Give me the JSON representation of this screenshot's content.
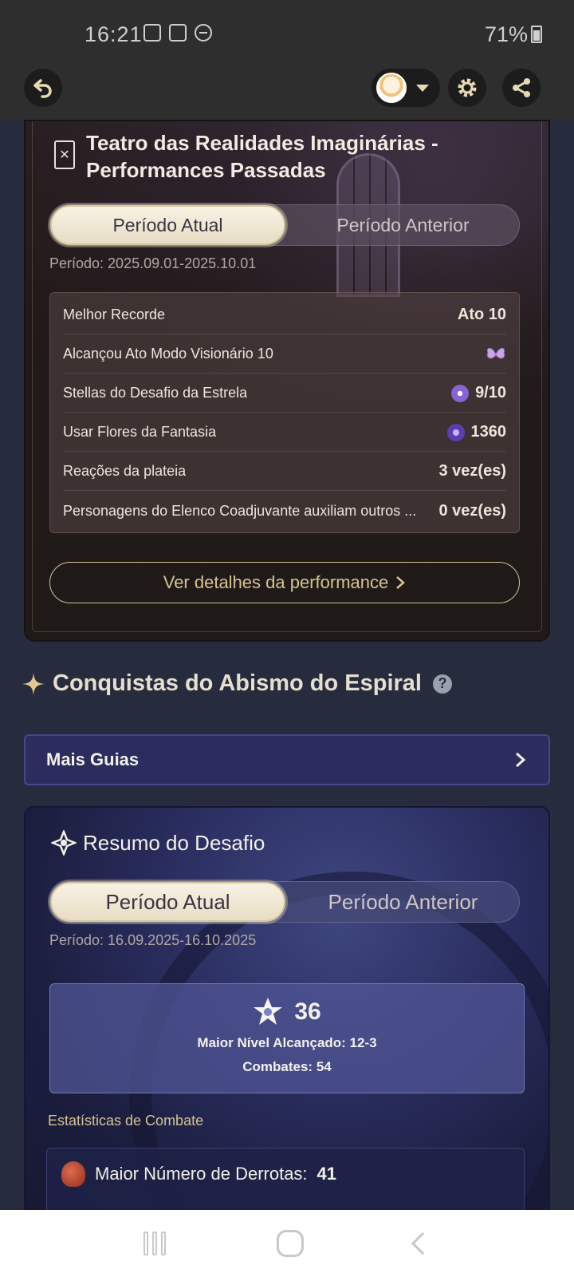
{
  "status_bar": {
    "time": "16:21",
    "battery": "71%"
  },
  "toolbar": {
    "back_icon": "back-arrow-icon",
    "settings_icon": "gear-icon",
    "share_icon": "share-icon"
  },
  "theater": {
    "title": "Teatro das Realidades Imaginárias - Performances Passadas",
    "tabs": [
      "Período Atual",
      "Período Anterior"
    ],
    "period": "Período: 2025.09.01-2025.10.01",
    "stats": [
      {
        "label": "Melhor Recorde",
        "value": "Ato 10"
      },
      {
        "label": "Alcançou Ato Modo Visionário 10",
        "value": ""
      },
      {
        "label": "Stellas do Desafio da Estrela",
        "value": "9/10"
      },
      {
        "label": "Usar Flores da Fantasia",
        "value": "1360"
      },
      {
        "label": "Reações da plateia",
        "value": "3 vez(es)"
      },
      {
        "label": "Personagens do Elenco Coadjuvante auxiliam outros ...",
        "value": "0 vez(es)"
      }
    ],
    "details_button": "Ver detalhes da performance"
  },
  "abyss": {
    "section_title": "Conquistas do Abismo do Espiral",
    "guides_label": "Mais Guias",
    "summary_title": "Resumo do Desafio",
    "tabs": [
      "Período Atual",
      "Período Anterior"
    ],
    "period": "Período: 16.09.2025-16.10.2025",
    "stars": "36",
    "max_floor": "Maior Nível Alcançado: 12-3",
    "battles": "Combates: 54",
    "combat_stats_label": "Estatísticas de Combate",
    "most_defeats_label": "Maior Número de Derrotas:",
    "most_defeats_value": "41"
  },
  "colors": {
    "gold_accent": "#d7c393",
    "page_bg": "#262c3d",
    "guides_bg": "#2b2d5e"
  }
}
